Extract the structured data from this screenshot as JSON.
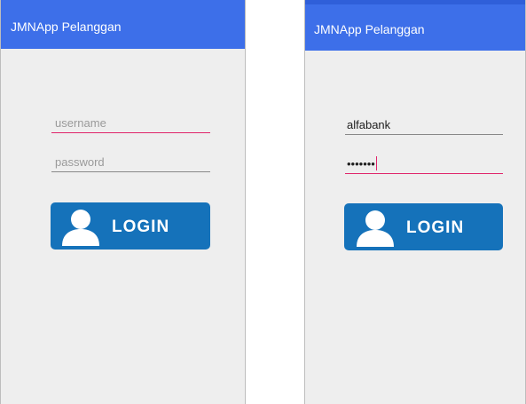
{
  "app_title": "JMNApp Pelanggan",
  "colors": {
    "appbar": "#3d6fe9",
    "accent": "#e0246a",
    "button": "#1572ba",
    "background": "#eeeeee"
  },
  "left_screen": {
    "username_placeholder": "username",
    "password_placeholder": "password",
    "login_label": "LOGIN"
  },
  "right_screen": {
    "username_value": "alfabank",
    "password_value": "•••••••",
    "login_label": "LOGIN"
  }
}
